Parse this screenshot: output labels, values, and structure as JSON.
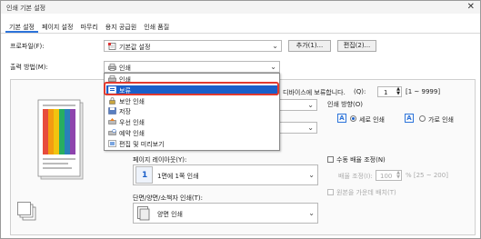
{
  "window": {
    "title": "인쇄 기본 설정",
    "close_glyph": "✕"
  },
  "tabs": [
    {
      "label": "기본 설정",
      "active": true
    },
    {
      "label": "페이지 설정"
    },
    {
      "label": "마무리"
    },
    {
      "label": "용지 공급원"
    },
    {
      "label": "인쇄 품질"
    }
  ],
  "profile": {
    "label": "프로파일(F):",
    "value": "기본값 설정",
    "add_button": "추가(1)...",
    "edit_button": "편집(2)..."
  },
  "output_method": {
    "label": "출력 방법(M):",
    "value": "인쇄"
  },
  "dropdown": {
    "items": [
      {
        "label": "인쇄",
        "icon": "printer-icon"
      },
      {
        "label": "보류",
        "icon": "hold-icon",
        "selected": true
      },
      {
        "label": "보안 인쇄",
        "icon": "lock-icon"
      },
      {
        "label": "저장",
        "icon": "save-icon"
      },
      {
        "label": "우선 인쇄",
        "icon": "priority-icon"
      },
      {
        "label": "예약 인쇄",
        "icon": "schedule-icon"
      },
      {
        "label": "편집 및 미리보기",
        "icon": "preview-icon"
      }
    ]
  },
  "hold_notice": "디바이스에 보류합니다.",
  "copies": {
    "label": "(Q):",
    "value": "1",
    "range": "[1 ~ 9999]"
  },
  "orientation": {
    "label": "인쇄 방향(O)",
    "portrait": "세로 인쇄",
    "landscape": "가로 인쇄",
    "selected": "portrait"
  },
  "page_layout": {
    "label": "페이지 레이아웃(Y):",
    "value": "1면에 1쪽 인쇄",
    "icon_number": "1"
  },
  "scaling": {
    "label": "수동 배율 조정(N)",
    "zoom_label": "배율 조정(I):",
    "zoom_value": "100",
    "zoom_range": "% [25 ~ 200]",
    "fit_label": "원본을 가운데 배치(T)"
  },
  "duplex": {
    "label": "단면/양면/소책자 인쇄(T):",
    "value": "양면 인쇄"
  },
  "colors": {
    "accent": "#1a5fc9",
    "highlight": "#e23a2e"
  }
}
